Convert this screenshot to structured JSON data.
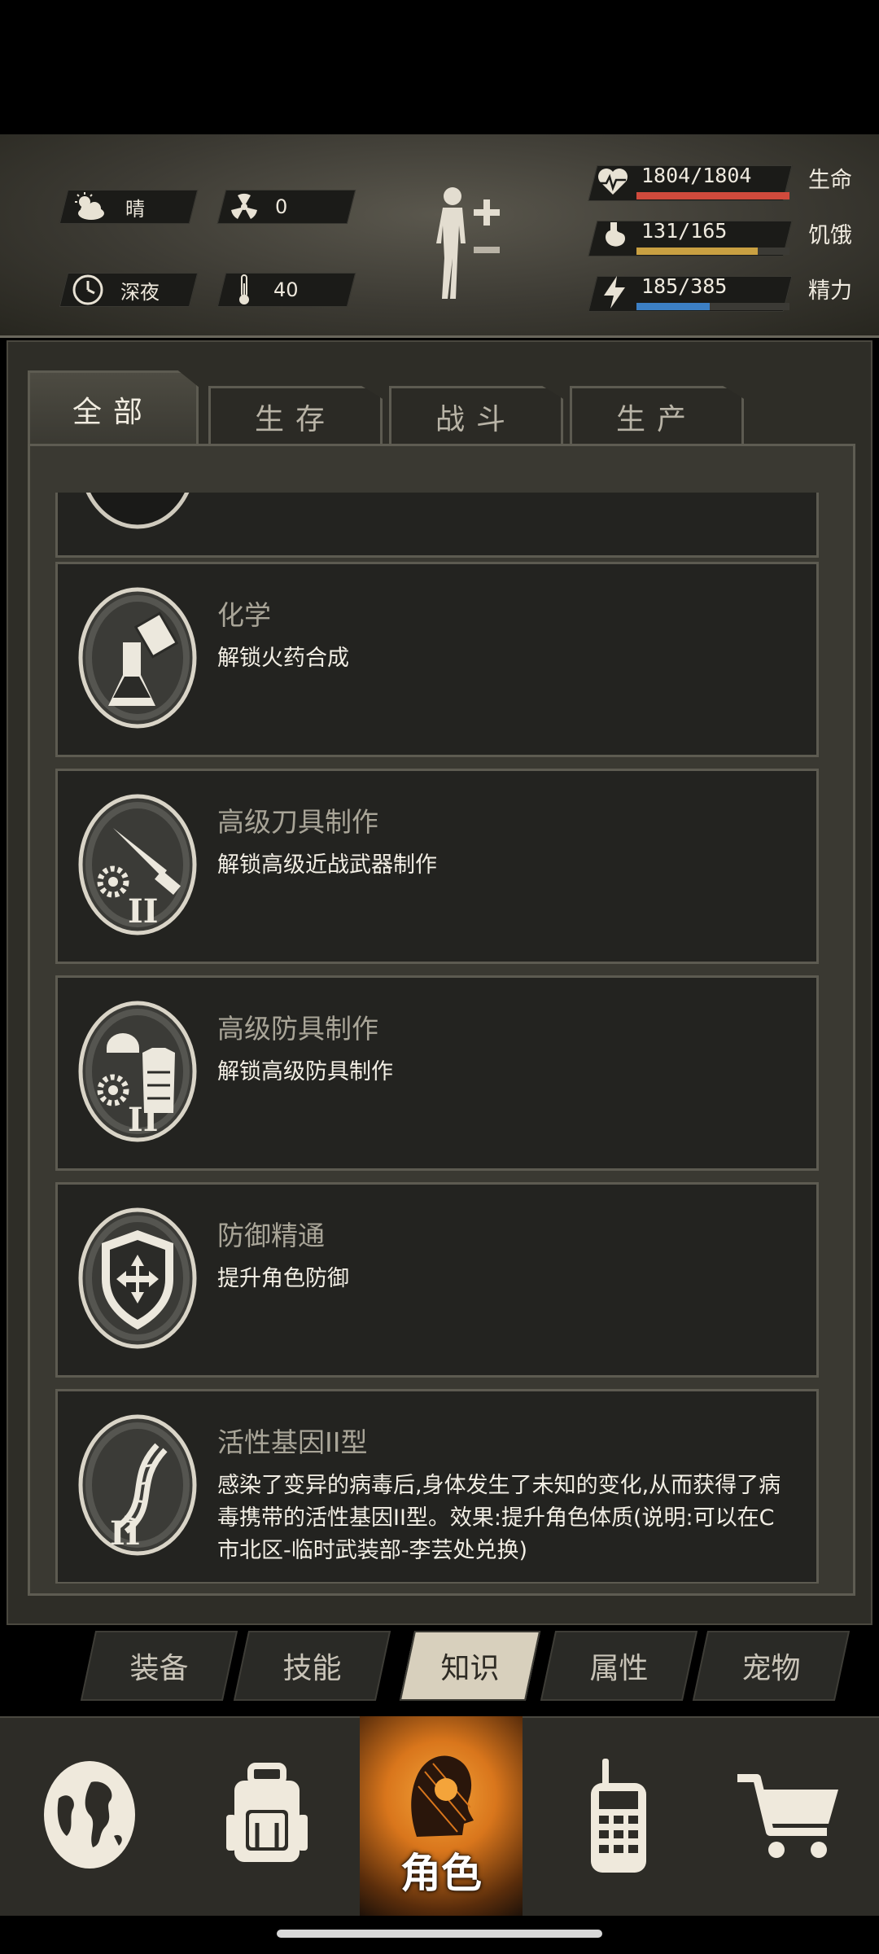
{
  "header": {
    "weather": "晴",
    "radiation": "0",
    "time_of_day": "深夜",
    "temperature": "40",
    "stats": [
      {
        "name": "生命",
        "value": "1804/1804",
        "fraction": 1.0,
        "color": "#d04a3c",
        "icon": "heart-rate-icon"
      },
      {
        "name": "饥饿",
        "value": "131/165",
        "fraction": 0.794,
        "color": "#c9a042",
        "icon": "stomach-icon"
      },
      {
        "name": "精力",
        "value": "185/385",
        "fraction": 0.48,
        "color": "#3c7fc4",
        "icon": "energy-icon"
      }
    ]
  },
  "tabs": [
    {
      "label": "全部",
      "active": true
    },
    {
      "label": "生存",
      "active": false
    },
    {
      "label": "战斗",
      "active": false
    },
    {
      "label": "生产",
      "active": false
    }
  ],
  "skills": [
    {
      "title": "化学",
      "desc": "解锁火药合成",
      "icon": "chemistry-flask-icon"
    },
    {
      "title": "高级刀具制作",
      "desc": "解锁高级近战武器制作",
      "icon": "knife-crafting-icon"
    },
    {
      "title": "高级防具制作",
      "desc": "解锁高级防具制作",
      "icon": "armor-crafting-icon"
    },
    {
      "title": "防御精通",
      "desc": "提升角色防御",
      "icon": "shield-icon"
    },
    {
      "title": "活性基因II型",
      "desc": "感染了变异的病毒后,身体发生了未知的变化,从而获得了病毒携带的活性基因II型。效果:提升角色体质(说明:可以在C市北区-临时武装部-李芸处兑换)",
      "icon": "dna-icon"
    }
  ],
  "subnav": [
    {
      "label": "装备",
      "active": false
    },
    {
      "label": "技能",
      "active": false
    },
    {
      "label": "知识",
      "active": true
    },
    {
      "label": "属性",
      "active": false
    },
    {
      "label": "宠物",
      "active": false
    }
  ],
  "bottomnav": {
    "active_label": "角色",
    "items": [
      "globe-icon",
      "backpack-icon",
      "character-icon",
      "radio-icon",
      "shopping-cart-icon"
    ]
  }
}
